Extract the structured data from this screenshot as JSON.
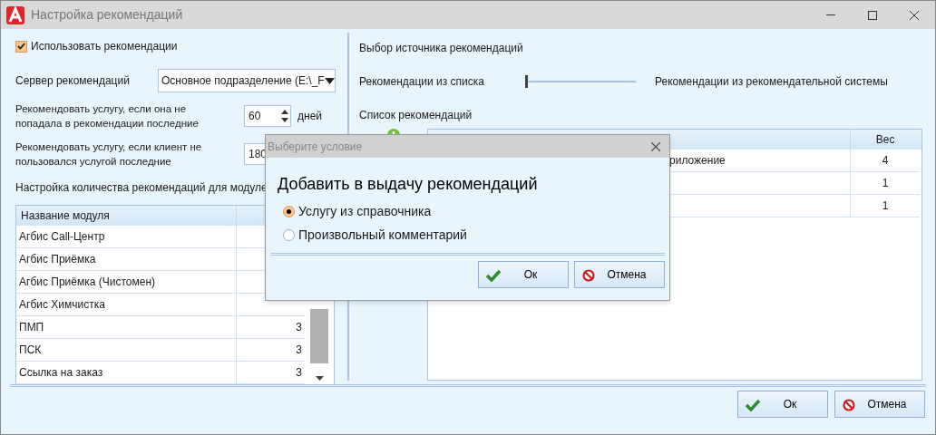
{
  "window": {
    "title": "Настройка рекомендаций"
  },
  "use_recommendations": {
    "label": "Использовать рекомендации",
    "checked": true
  },
  "server": {
    "label": "Сервер рекомендаций",
    "value": "Основное подразделение (E:\\_F"
  },
  "repeat_service": {
    "label": "Рекомендовать услугу, если она не попадала в рекомендации последние",
    "value": "60",
    "unit": "дней"
  },
  "client_unused": {
    "label": "Рекомендовать услугу, если клиент не пользовался услугой последние",
    "value": "180"
  },
  "modules_label": "Настройка количества рекомендаций для модуле",
  "modules_table": {
    "columns": [
      "Название модуля"
    ],
    "rows": [
      {
        "name": "Агбис Call-Центр"
      },
      {
        "name": "Агбис Приёмка"
      },
      {
        "name": "Агбис Приёмка (Чистомен)"
      },
      {
        "name": "Агбис Химчистка"
      },
      {
        "name": "ПМП",
        "count": "3"
      },
      {
        "name": "ПСК",
        "count": "3"
      },
      {
        "name": "Ссылка на заказ",
        "count": "3"
      }
    ]
  },
  "source": {
    "title": "Выбор источника рекомендаций",
    "left_label": "Рекомендации из списка",
    "right_label": "Рекомендации из рекомендательной системы",
    "level": 0
  },
  "list_label": "Список рекомендаций",
  "list_table": {
    "columns": [
      "Вес"
    ],
    "rows": [
      {
        "name": "риложение",
        "weight": "4"
      },
      {
        "weight": "1"
      },
      {
        "weight": "1"
      }
    ]
  },
  "buttons": [
    {
      "label": "Ок",
      "kind": "ok"
    },
    {
      "label": "Отмена",
      "kind": "cancel"
    }
  ],
  "dialog": {
    "title": "Выберите условие",
    "heading": "Добавить в выдачу рекомендаций",
    "options": [
      {
        "label": "Услугу из справочника",
        "selected": true
      },
      {
        "label": "Произвольный комментарий",
        "selected": false
      }
    ],
    "buttons": [
      {
        "label": "Ок",
        "kind": "ok"
      },
      {
        "label": "Отмена",
        "kind": "cancel"
      }
    ]
  }
}
